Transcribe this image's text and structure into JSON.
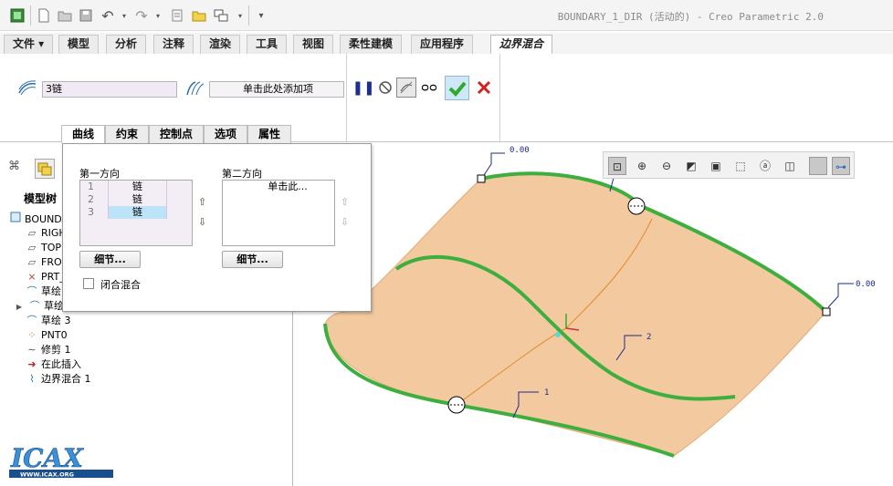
{
  "window": {
    "title": "BOUNDARY_1_DIR (活动的) - Creo Parametric 2.0"
  },
  "ribbon_tabs": [
    {
      "label": "文件 ▾"
    },
    {
      "label": "模型"
    },
    {
      "label": "分析"
    },
    {
      "label": "注释"
    },
    {
      "label": "渲染"
    },
    {
      "label": "工具"
    },
    {
      "label": "视图"
    },
    {
      "label": "柔性建模"
    },
    {
      "label": "应用程序"
    },
    {
      "label": "边界混合"
    }
  ],
  "ribbon": {
    "first_dir_value": "3链",
    "second_dir_value": "单击此处添加项"
  },
  "sub_tabs": [
    {
      "label": "曲线"
    },
    {
      "label": "约束"
    },
    {
      "label": "控制点"
    },
    {
      "label": "选项"
    },
    {
      "label": "属性"
    }
  ],
  "panel": {
    "first_dir_label": "第一方向",
    "second_dir_label": "第二方向",
    "first_dir_items": [
      {
        "index": "1",
        "label": "链"
      },
      {
        "index": "2",
        "label": "链"
      },
      {
        "index": "3",
        "label": "链"
      }
    ],
    "second_dir_placeholder": "单击此...",
    "detail_button_1": "细节...",
    "detail_button_2": "细节...",
    "closed_blend_label": "闭合混合",
    "closed_blend_checked": false
  },
  "model_tree": {
    "header_label": "模型树",
    "items": [
      {
        "label": "BOUNDARY_",
        "icon": "part-icon"
      },
      {
        "label": "RIGHT",
        "icon": "datum-plane-icon"
      },
      {
        "label": "TOP",
        "icon": "datum-plane-icon"
      },
      {
        "label": "FRONT",
        "icon": "datum-plane-icon"
      },
      {
        "label": "PRT_",
        "icon": "csys-icon"
      },
      {
        "label": "草绘",
        "icon": "sketch-icon"
      },
      {
        "label": "草绘",
        "icon": "sketch-icon"
      },
      {
        "label": "草绘 3",
        "icon": "sketch-icon"
      },
      {
        "label": "PNT0",
        "icon": "datum-point-icon"
      },
      {
        "label": "修剪 1",
        "icon": "trim-icon"
      },
      {
        "label": "在此插入",
        "icon": "insert-here-arrow-icon"
      },
      {
        "label": "边界混合 1",
        "icon": "boundary-blend-icon"
      }
    ]
  },
  "graphics": {
    "dim_top_left": "0.00",
    "dim_right": "0.00",
    "label_curve_1": "1",
    "label_curve_2": "2",
    "surface_color": "#f3c9a0",
    "curve_color": "#3eaf3e"
  },
  "logo": {
    "brand": "ICAX",
    "url_text": "WWW.ICAX.ORG"
  },
  "colors": {
    "accept_green": "#2ea82e",
    "cancel_red": "#d42020",
    "list_select": "#bde3f9"
  }
}
